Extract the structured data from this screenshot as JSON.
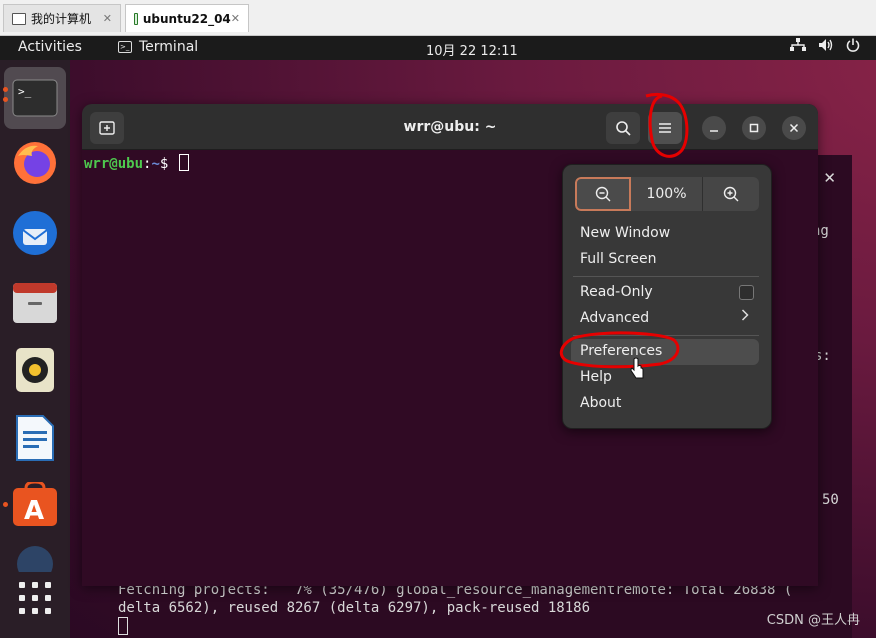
{
  "host_tabs": [
    {
      "label": "我的计算机",
      "close": "✕"
    },
    {
      "label": "ubuntu22_04",
      "close": "✕"
    }
  ],
  "topbar": {
    "activities": "Activities",
    "app_name": "Terminal",
    "clock": "10月 22  12:11",
    "tray_icons": [
      "network-icon",
      "volume-icon",
      "power-icon"
    ]
  },
  "dock": {
    "items": [
      "terminal-icon",
      "firefox-icon",
      "thunderbird-icon",
      "files-icon",
      "rhythmbox-icon",
      "writer-icon",
      "app-center-icon",
      "show-apps-icon"
    ]
  },
  "terminal": {
    "title": "wrr@ubu: ~",
    "prompt_user": "wrr@ubu",
    "prompt_sep": ":",
    "prompt_path": "~",
    "prompt_symbol": "$ "
  },
  "menu": {
    "zoom_level": "100%",
    "items": {
      "new_window": "New Window",
      "full_screen": "Full Screen",
      "read_only": "Read-Only",
      "advanced": "Advanced",
      "preferences": "Preferences",
      "help": "Help",
      "about": "About"
    }
  },
  "background_terminal": {
    "close": "✕",
    "fragments": [
      "ng",
      "s:",
      "50"
    ],
    "line1": "Fetching projects:   7% (35/476) global_resource_managementremote: Total 26838 (",
    "line2": "delta 6562), reused 8267 (delta 6297), pack-reused 18186"
  },
  "watermark": "CSDN @王人冉",
  "colors": {
    "desktop": "#6a1a3f",
    "terminal_bg": "#300a24",
    "prompt_user": "#4ec94e",
    "prompt_path": "#6b8bd6",
    "annotation": "#e60000"
  }
}
